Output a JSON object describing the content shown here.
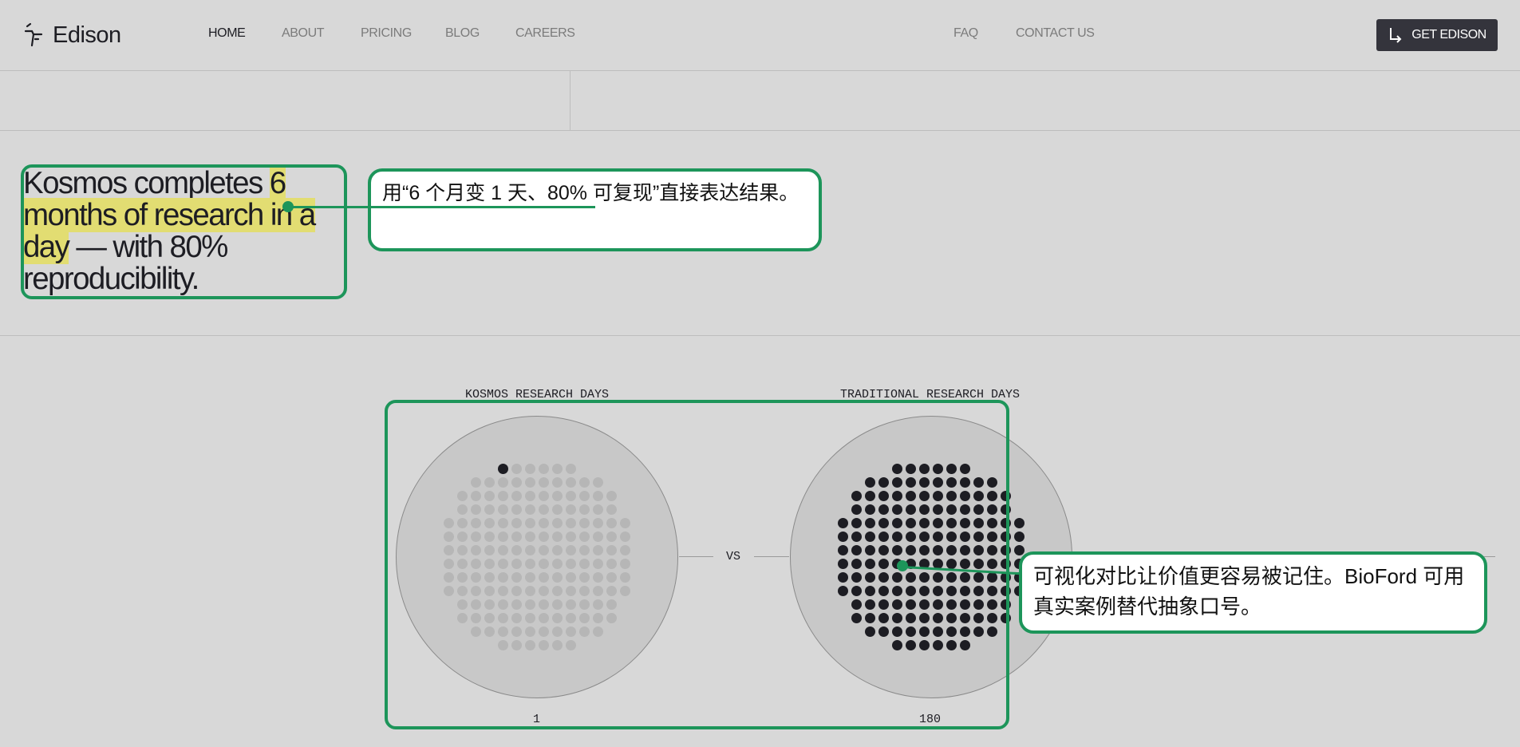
{
  "nav": {
    "logo_text": "Edison",
    "links": [
      "HOME",
      "ABOUT",
      "PRICING",
      "BLOG",
      "CAREERS"
    ],
    "right_links": [
      "FAQ",
      "CONTACT US"
    ],
    "cta_label": "GET EDISON"
  },
  "hero": {
    "part1": "Kosmos completes ",
    "highlight1": "6",
    "highlight2": "months of research in a",
    "highlight3": "day",
    "part2": " —  with 80%",
    "part3": "reproducibility."
  },
  "annotations": {
    "note1": "用“6 个月变 1 天、80% 可复现”直接表达结果。",
    "note2": "可视化对比让价值更容易被记住。BioFord 可用真实案例替代抽象口号。"
  },
  "comparison": {
    "left_label": "KOSMOS RESEARCH DAYS",
    "right_label": "TRADITIONAL RESEARCH DAYS",
    "vs_label": "VS",
    "left_value": "1",
    "right_value": "180",
    "filled_color": "#1d1d23",
    "empty_color": "#b6b6b6"
  }
}
